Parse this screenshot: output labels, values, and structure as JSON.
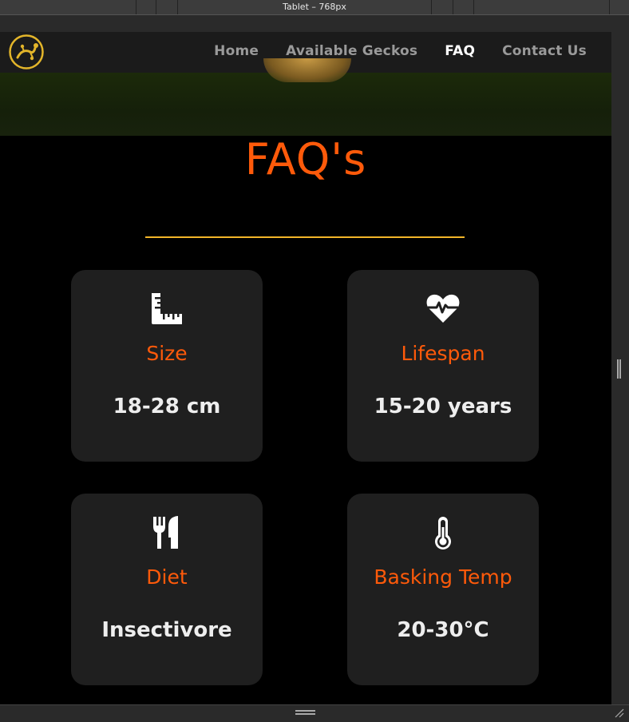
{
  "device": {
    "title": "Tablet – 768px"
  },
  "nav": {
    "links": [
      {
        "label": "Home",
        "active": false
      },
      {
        "label": "Available Geckos",
        "active": false
      },
      {
        "label": "FAQ",
        "active": true
      },
      {
        "label": "Contact Us",
        "active": false
      }
    ],
    "logo_color": "#e3b52a"
  },
  "faq": {
    "title": "FAQ's",
    "cards": [
      {
        "icon": "ruler-icon",
        "label": "Size",
        "value": "18-28 cm"
      },
      {
        "icon": "heartbeat-icon",
        "label": "Lifespan",
        "value": "15-20 years"
      },
      {
        "icon": "utensils-icon",
        "label": "Diet",
        "value": "Insectivore"
      },
      {
        "icon": "thermometer-icon",
        "label": "Basking Temp",
        "value": "20-30°C"
      }
    ]
  },
  "colors": {
    "accent": "#ff5a0a",
    "divider": "#f2b529",
    "card_bg": "#1f1f1f",
    "page_bg": "#000000",
    "nav_bg": "#1b1b1b"
  }
}
